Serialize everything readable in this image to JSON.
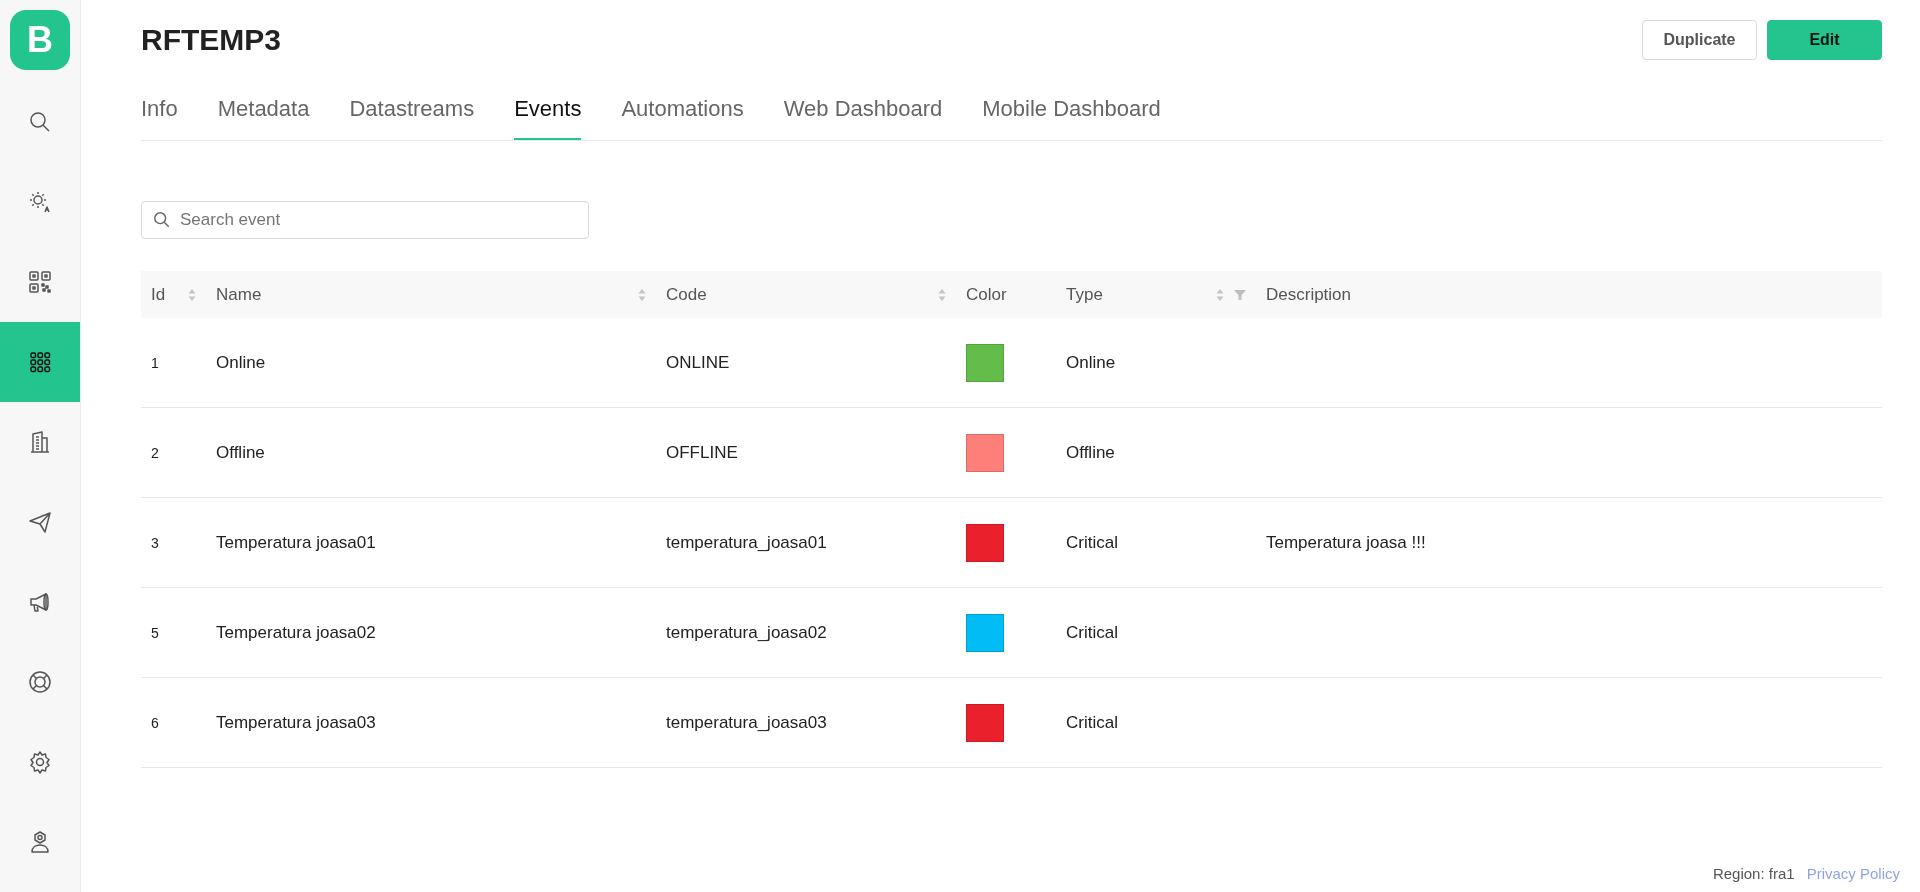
{
  "sidebar": {
    "logo": "B",
    "items": [
      {
        "selected": false
      },
      {
        "selected": false
      },
      {
        "selected": false
      },
      {
        "selected": true
      },
      {
        "selected": false
      },
      {
        "selected": false
      },
      {
        "selected": false
      },
      {
        "selected": false
      },
      {
        "selected": false
      },
      {
        "selected": false
      }
    ]
  },
  "title": "RFTEMP3",
  "buttons": [
    {
      "label": "Duplicate",
      "kind": "secondary"
    },
    {
      "label": "Edit",
      "kind": "primary"
    }
  ],
  "tabs": [
    {
      "label": "Info",
      "selected": false
    },
    {
      "label": "Metadata",
      "selected": false
    },
    {
      "label": "Datastreams",
      "selected": false
    },
    {
      "label": "Events",
      "selected": true
    },
    {
      "label": "Automations",
      "selected": false
    },
    {
      "label": "Web Dashboard",
      "selected": false
    },
    {
      "label": "Mobile Dashboard",
      "selected": false
    }
  ],
  "search": {
    "placeholder": "Search event"
  },
  "table": {
    "columns": [
      {
        "label": "Id",
        "sortable": true,
        "filterable": false
      },
      {
        "label": "Name",
        "sortable": true,
        "filterable": false
      },
      {
        "label": "Code",
        "sortable": true,
        "filterable": false
      },
      {
        "label": "Color",
        "sortable": false,
        "filterable": false
      },
      {
        "label": "Type",
        "sortable": true,
        "filterable": true
      },
      {
        "label": "Description",
        "sortable": false,
        "filterable": false
      }
    ],
    "rows": [
      {
        "id": "1",
        "name": "Online",
        "code": "ONLINE",
        "color": "#64bd4a",
        "type": "Online",
        "description": ""
      },
      {
        "id": "2",
        "name": "Offline",
        "code": "OFFLINE",
        "color": "#fe7f79",
        "type": "Offline",
        "description": ""
      },
      {
        "id": "3",
        "name": "Temperatura joasa01",
        "code": "temperatura_joasa01",
        "color": "#ea212d",
        "type": "Critical",
        "description": "Temperatura joasa !!!"
      },
      {
        "id": "5",
        "name": "Temperatura joasa02",
        "code": "temperatura_joasa02",
        "color": "#02bcf5",
        "type": "Critical",
        "description": ""
      },
      {
        "id": "6",
        "name": "Temperatura joasa03",
        "code": "temperatura_joasa03",
        "color": "#ea212d",
        "type": "Critical",
        "description": ""
      }
    ]
  },
  "footer": {
    "region": "Region: fra1",
    "link": "Privacy Policy"
  }
}
